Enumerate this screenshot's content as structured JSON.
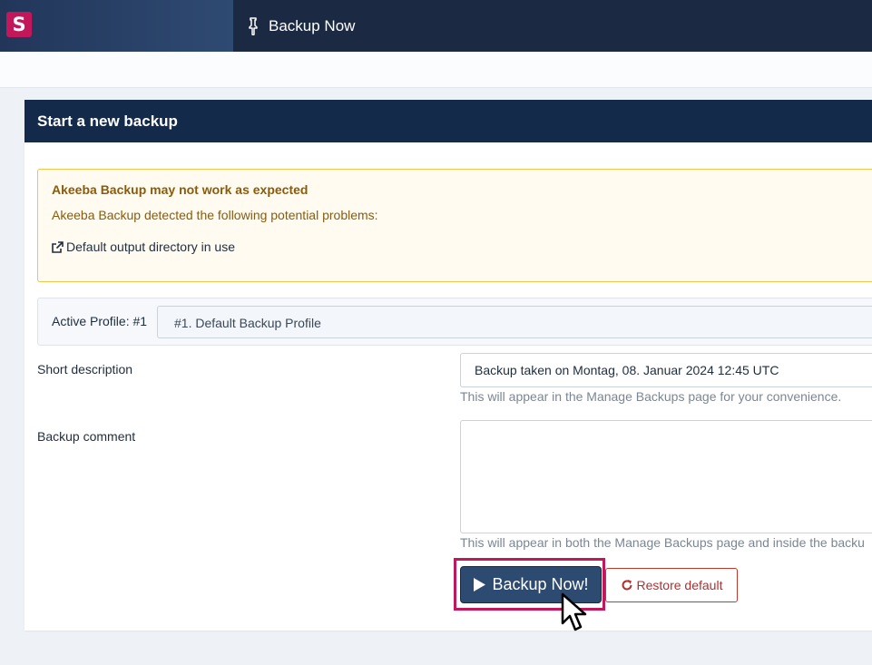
{
  "app": {
    "logo_letter": "S",
    "page_title": "Backup Now",
    "title_icon": "pin-icon",
    "brand_color": "#c2185b"
  },
  "card": {
    "title": "Start a new backup"
  },
  "alert": {
    "heading": "Akeeba Backup may not work as expected",
    "text": "Akeeba Backup detected the following potential problems:",
    "link_label": "Default output directory in use",
    "link_icon": "external-link-icon"
  },
  "profile": {
    "label": "Active Profile: #1",
    "selected": "#1. Default Backup Profile"
  },
  "form": {
    "description_label": "Short description",
    "description_value": "Backup taken on Montag, 08. Januar 2024 12:45 UTC",
    "description_help": "This will appear in the Manage Backups page for your convenience.",
    "comment_label": "Backup comment",
    "comment_value": "",
    "comment_help": "This will appear in both the Manage Backups page and inside the backu"
  },
  "buttons": {
    "backup_now": "Backup Now!",
    "backup_icon": "play-icon",
    "restore_default": "Restore default",
    "restore_icon": "refresh-icon"
  }
}
